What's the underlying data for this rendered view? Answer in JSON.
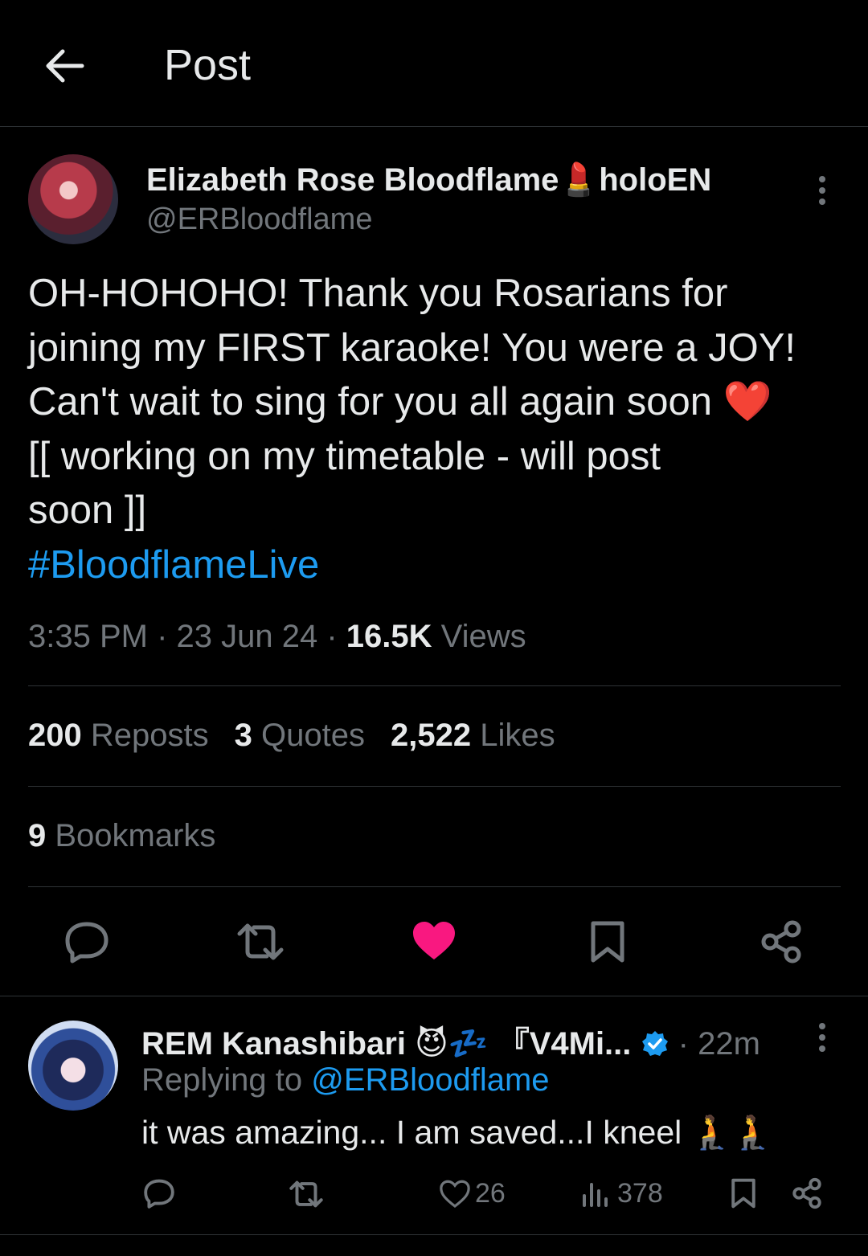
{
  "header": {
    "title": "Post"
  },
  "post": {
    "author_name": "Elizabeth Rose Bloodflame💄holoEN",
    "author_handle": "@ERBloodflame",
    "text_lines": [
      "OH-HOHOHO! Thank you Rosarians for",
      "joining my FIRST karaoke! You were a JOY!",
      "Can't wait to sing for you all again soon ❤️",
      "[[ working on my timetable - will post",
      "soon ]]"
    ],
    "hashtag": "#BloodflameLive",
    "time": "3:35 PM",
    "date": "23 Jun 24",
    "views_count": "16.5K",
    "views_label": "Views",
    "reposts_count": "200",
    "reposts_label": "Reposts",
    "quotes_count": "3",
    "quotes_label": "Quotes",
    "likes_count": "2,522",
    "likes_label": "Likes",
    "bookmarks_count": "9",
    "bookmarks_label": "Bookmarks",
    "liked": true
  },
  "colors": {
    "accent": "#1d9bf0",
    "like": "#f91880",
    "muted": "#71767b",
    "text": "#e7e9ea",
    "border": "#2f3336"
  },
  "reply": {
    "author_name": "REM Kanashibari 😈💤 『V4Mi...",
    "time": "22m",
    "replying_prefix": "Replying to",
    "replying_handle": "@ERBloodflame",
    "text": "it was amazing... I am saved...I kneel 🧎🧎",
    "likes": "26",
    "views": "378"
  },
  "icons": [
    "back-arrow-icon",
    "more-icon",
    "reply-icon",
    "repost-icon",
    "like-icon",
    "bookmark-icon",
    "share-icon",
    "views-icon",
    "verified-icon"
  ]
}
